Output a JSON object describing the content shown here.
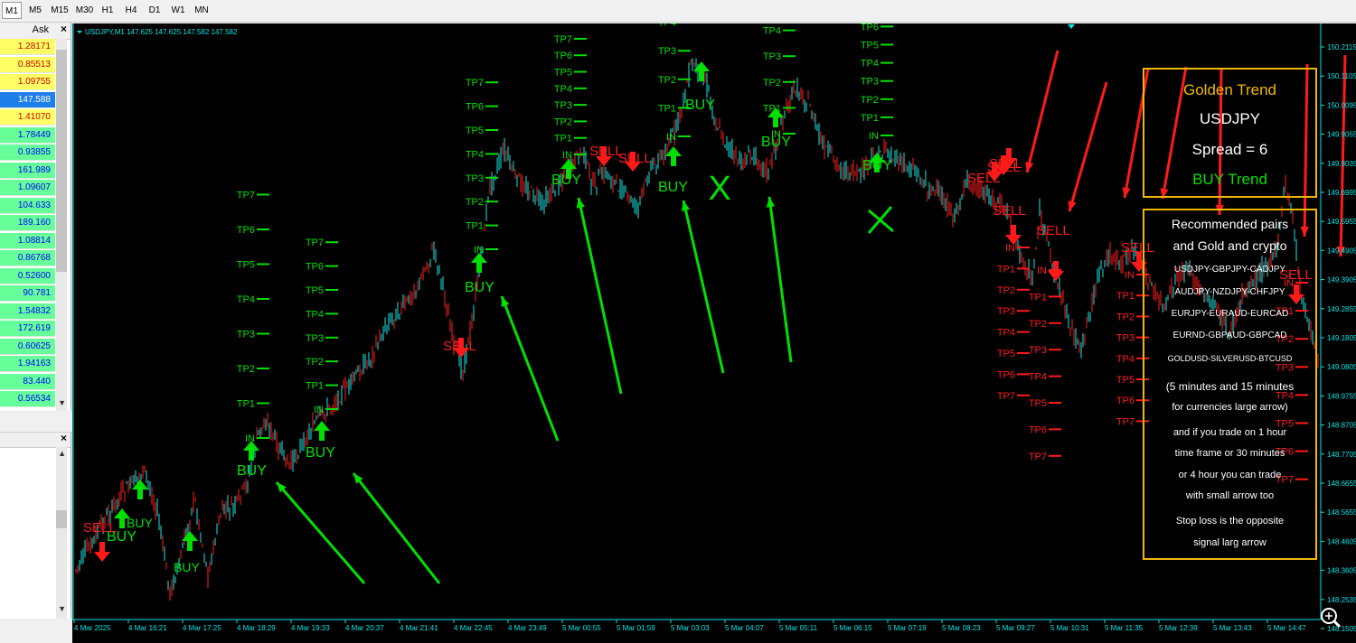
{
  "timeframes": [
    "M1",
    "M5",
    "M15",
    "M30",
    "H1",
    "H4",
    "D1",
    "W1",
    "MN"
  ],
  "market_watch": {
    "header": "Ask",
    "rows": [
      {
        "value": "1.28171",
        "color": "#ffff66"
      },
      {
        "value": "0.85513",
        "color": "#ffff66"
      },
      {
        "value": "1.09755",
        "color": "#ffff66"
      },
      {
        "value": "147.588",
        "color": "#1e7fe8"
      },
      {
        "value": "1.41070",
        "color": "#ffff66"
      },
      {
        "value": "1.78449",
        "color": "#66ff99"
      },
      {
        "value": "0.93855",
        "color": "#66ff99"
      },
      {
        "value": "161.989",
        "color": "#66ff99"
      },
      {
        "value": "1.09607",
        "color": "#66ff99"
      },
      {
        "value": "104.633",
        "color": "#66ff99"
      },
      {
        "value": "189.160",
        "color": "#66ff99"
      },
      {
        "value": "1.08814",
        "color": "#66ff99"
      },
      {
        "value": "0.86768",
        "color": "#66ff99"
      },
      {
        "value": "0.52600",
        "color": "#66ff99"
      },
      {
        "value": "90.781",
        "color": "#66ff99"
      },
      {
        "value": "1.54832",
        "color": "#66ff99"
      },
      {
        "value": "172.619",
        "color": "#66ff99"
      },
      {
        "value": "0.60625",
        "color": "#66ff99"
      },
      {
        "value": "1.94163",
        "color": "#66ff99"
      },
      {
        "value": "83.440",
        "color": "#66ff99"
      },
      {
        "value": "0.56534",
        "color": "#66ff99"
      }
    ]
  },
  "chart": {
    "title": "USDJPY,M1  147.625 147.625 147.582 147.582",
    "price_labels": [
      "150.2115",
      "150.1105",
      "150.0095",
      "149.9055",
      "149.8035",
      "149.6995",
      "149.5955",
      "149.4905",
      "149.3905",
      "149.2855",
      "149.1805",
      "149.0805",
      "148.9755",
      "148.8705",
      "148.7705",
      "148.6655",
      "148.5655",
      "148.4605",
      "148.3605",
      "148.2535",
      "148.1505"
    ],
    "time_labels": [
      "4 Mar 2025",
      "4 Mar 16:21",
      "4 Mar 17:25",
      "4 Mar 18:29",
      "4 Mar 19:33",
      "4 Mar 20:37",
      "4 Mar 21:41",
      "4 Mar 22:45",
      "4 Mar 23:49",
      "5 Mar 00:55",
      "5 Mar 01:59",
      "5 Mar 03:03",
      "5 Mar 04:07",
      "5 Mar 05:11",
      "5 Mar 06:15",
      "5 Mar 07:19",
      "5 Mar 08:23",
      "5 Mar 09:27",
      "5 Mar 10:31",
      "5 Mar 11:35",
      "5 Mar 12:39",
      "5 Mar 13:43",
      "5 Mar 14:47"
    ],
    "colors": {
      "up": "#19e6e6",
      "down": "#ff2020",
      "buy": "#00e000",
      "sell": "#ff1a1a",
      "bg": "#000000",
      "axis": "#00e6e6",
      "box": "#f0b800"
    }
  },
  "buy_signals": [
    {
      "label": "BUY"
    },
    {
      "label": "BUY"
    },
    {
      "label": "BUY"
    },
    {
      "label": "BUY"
    },
    {
      "label": "BUY"
    },
    {
      "label": "BUY"
    },
    {
      "label": "BUY"
    },
    {
      "label": "BUY"
    },
    {
      "label": "BUY"
    },
    {
      "label": "BUY"
    },
    {
      "label": "BUY"
    }
  ],
  "sell_signals": [
    {
      "label": "SELL"
    },
    {
      "label": "SELL"
    },
    {
      "label": "SELL"
    },
    {
      "label": "SELL"
    },
    {
      "label": "SELL"
    },
    {
      "label": "SELL"
    },
    {
      "label": "SELL"
    },
    {
      "label": "SELL"
    },
    {
      "label": "SELL"
    },
    {
      "label": "SELL"
    },
    {
      "label": "SELL"
    }
  ],
  "info_box": {
    "title": "Golden Trend",
    "symbol": "USDJPY",
    "spread": "Spread = 6",
    "trend": "BUY Trend"
  },
  "recommend_box": {
    "lines": [
      "Recommended pairs",
      "and Gold and crypto",
      "USDJPY-GBPJPY-CADJPY",
      "AUDJPY-NZDJPY-CHFJPY",
      "EURJPY-EURAUD-EURCAD",
      "EURND-GBPAUD-GBPCAD",
      "GOLDUSD-SILVERUSD-BTCUSD",
      "(5 minutes and 15 minutes",
      "for currencies large arrow)",
      "and if you trade on 1 hour",
      "time frame or 30 minutes",
      "or 4 hour you can trade",
      "with small arrow too",
      "Stop loss is the opposite",
      "signal larg arrow"
    ]
  },
  "trade_labels": {
    "entry": "IN",
    "tp": [
      "TP1",
      "TP2",
      "TP3",
      "TP4",
      "TP5",
      "TP6",
      "TP7"
    ],
    "invalid_mark": "X"
  }
}
